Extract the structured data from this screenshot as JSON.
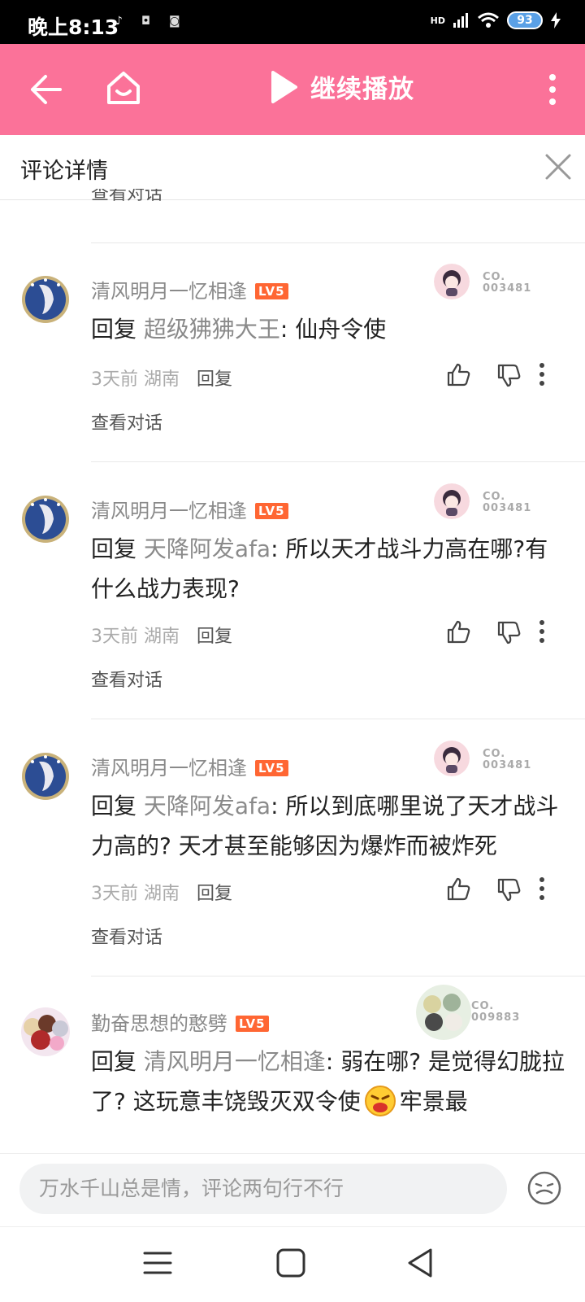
{
  "status_bar": {
    "time": "晚上8:13",
    "network": "HD",
    "battery": "93"
  },
  "header": {
    "continue_label": "继续播放"
  },
  "sub_header": {
    "title": "评论详情"
  },
  "peek_view_conversation": "查看对话",
  "comments": [
    {
      "username": "清风明月一忆相逢",
      "level": "LV5",
      "badge_no_line1": "CO.",
      "badge_no_line2": "003481",
      "reply_prefix": "回复 ",
      "reply_to": "超级狒狒大王",
      "text": ": 仙舟令使",
      "time": "3天前",
      "location": "湖南",
      "reply_label": "回复",
      "view_conversation": "查看对话"
    },
    {
      "username": "清风明月一忆相逢",
      "level": "LV5",
      "badge_no_line1": "CO.",
      "badge_no_line2": "003481",
      "reply_prefix": "回复 ",
      "reply_to": "天降阿发afa",
      "text": ": 所以天才战斗力高在哪?有什么战力表现?",
      "time": "3天前",
      "location": "湖南",
      "reply_label": "回复",
      "view_conversation": "查看对话"
    },
    {
      "username": "清风明月一忆相逢",
      "level": "LV5",
      "badge_no_line1": "CO.",
      "badge_no_line2": "003481",
      "reply_prefix": "回复 ",
      "reply_to": "天降阿发afa",
      "text": ": 所以到底哪里说了天才战斗力高的? 天才甚至能够因为爆炸而被炸死",
      "time": "3天前",
      "location": "湖南",
      "reply_label": "回复",
      "view_conversation": "查看对话"
    },
    {
      "username": "勤奋思想的憨劈",
      "level": "LV5",
      "badge_no_line1": "CO.",
      "badge_no_line2": "009883",
      "reply_prefix": "回复 ",
      "reply_to": "清风明月一忆相逢",
      "text_before_emoji": ": 弱在哪? 是觉得幻胧拉了? 这玩意丰饶毁灭双令使",
      "text_after_emoji": "牢景最"
    }
  ],
  "input_bar": {
    "placeholder": "万水千山总是情，评论两句行不行"
  }
}
